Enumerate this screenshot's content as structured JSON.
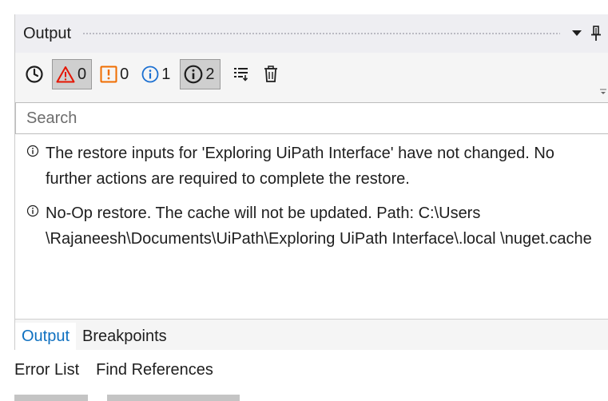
{
  "panel": {
    "title": "Output"
  },
  "toolbar": {
    "timestamps_tooltip": "Show Timestamps",
    "errors_count": "0",
    "warnings_count": "0",
    "info_count": "1",
    "trace_count": "2"
  },
  "search": {
    "placeholder": "Search",
    "value": ""
  },
  "messages": [
    {
      "text": "The restore inputs for 'Exploring UiPath Interface' have not changed. No further actions are required to complete the restore."
    },
    {
      "text": "No-Op restore. The cache will not be updated. Path: C:\\Users \\Rajaneesh\\Documents\\UiPath\\Exploring UiPath Interface\\.local \\nuget.cache"
    }
  ],
  "tabs": [
    {
      "label": "Output",
      "active": true
    },
    {
      "label": "Breakpoints",
      "active": false
    }
  ],
  "lower_tabs": [
    {
      "label": "Error List"
    },
    {
      "label": "Find References"
    }
  ],
  "colors": {
    "error": "#e51400",
    "warning": "#f06d00",
    "info": "#1a6fd1",
    "active_tab": "#0e70c0"
  }
}
